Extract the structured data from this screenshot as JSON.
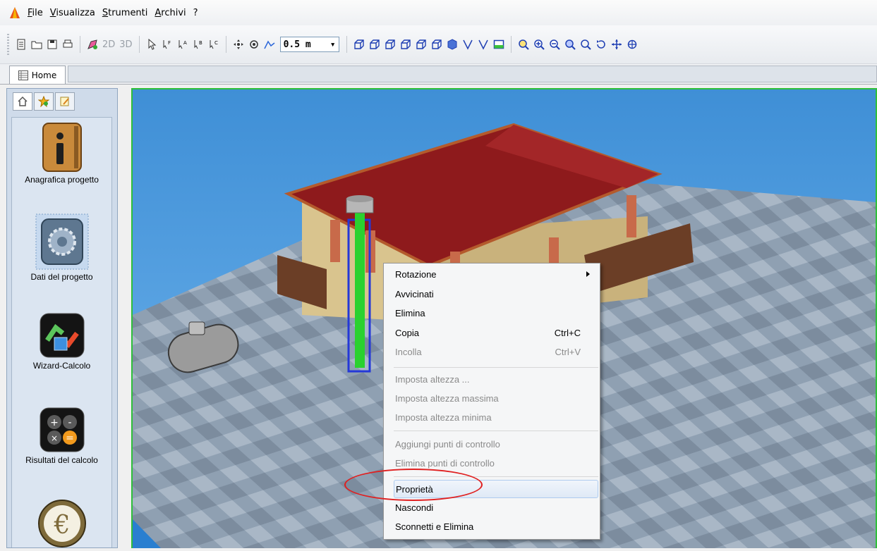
{
  "menubar": {
    "items": [
      "File",
      "Visualizza",
      "Strumenti",
      "Archivi",
      "?"
    ]
  },
  "toolbar": {
    "view_2d_label": "2D",
    "view_3d_label": "3D",
    "scale_value": "0.5 m"
  },
  "tabs": [
    {
      "label": "Home"
    }
  ],
  "sidebar": {
    "items": [
      {
        "label": "Anagrafica progetto",
        "icon": "info-book-icon"
      },
      {
        "label": "Dati del progetto",
        "icon": "gear-icon"
      },
      {
        "label": "Wizard-Calcolo",
        "icon": "wizard-arrows-icon"
      },
      {
        "label": "Risultati del calcolo",
        "icon": "calculator-icon"
      },
      {
        "label": "",
        "icon": "euro-icon"
      }
    ]
  },
  "context_menu": {
    "items": [
      {
        "label": "Rotazione",
        "shortcut": "",
        "disabled": false,
        "submenu": true
      },
      {
        "label": "Avvicinati",
        "shortcut": "",
        "disabled": false
      },
      {
        "label": "Elimina",
        "shortcut": "",
        "disabled": false
      },
      {
        "label": "Copia",
        "shortcut": "Ctrl+C",
        "disabled": false
      },
      {
        "label": "Incolla",
        "shortcut": "Ctrl+V",
        "disabled": true
      },
      {
        "label": "Imposta altezza ...",
        "shortcut": "",
        "disabled": true
      },
      {
        "label": "Imposta altezza massima",
        "shortcut": "",
        "disabled": true
      },
      {
        "label": "Imposta altezza minima",
        "shortcut": "",
        "disabled": true
      },
      {
        "label": "Aggiungi punti di controllo",
        "shortcut": "",
        "disabled": true
      },
      {
        "label": "Elimina punti di controllo",
        "shortcut": "",
        "disabled": true
      },
      {
        "label": "Proprietà",
        "shortcut": "",
        "disabled": false,
        "highlighted": true
      },
      {
        "label": "Nascondi",
        "shortcut": "",
        "disabled": false
      },
      {
        "label": "Sconnetti e Elimina",
        "shortcut": "",
        "disabled": false
      }
    ]
  },
  "colors": {
    "viewport_border": "#2fbf3a",
    "roof": "#8e1a1c",
    "sky": "#3f8fd6",
    "annotation": "#e02020"
  }
}
